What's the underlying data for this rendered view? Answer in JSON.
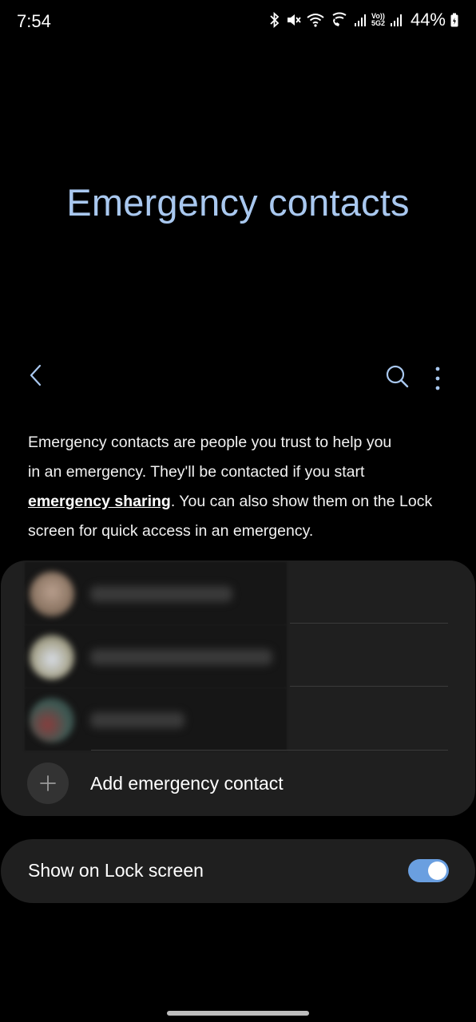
{
  "status_bar": {
    "time": "7:54",
    "battery": "44%",
    "network_label_top": "Vo))",
    "network_label_bottom": "5G2"
  },
  "page": {
    "title": "Emergency contacts"
  },
  "toolbar": {
    "back_icon": "chevron-left-icon",
    "search_icon": "search-icon",
    "more_icon": "more-vertical-icon",
    "accent": "#a9c8ef"
  },
  "description": {
    "line1": "Emergency contacts are people you trust to help you",
    "line2": "in an emergency. They'll be contacted if you start",
    "link": "emergency sharing",
    "line3_rest": ". You can also show them on the Lock",
    "line4": "screen for quick access in an emergency."
  },
  "contacts": {
    "add_label": "Add emergency contact"
  },
  "lock_screen": {
    "label": "Show on Lock screen",
    "enabled": true,
    "toggle_color": "#6a9fe0"
  }
}
